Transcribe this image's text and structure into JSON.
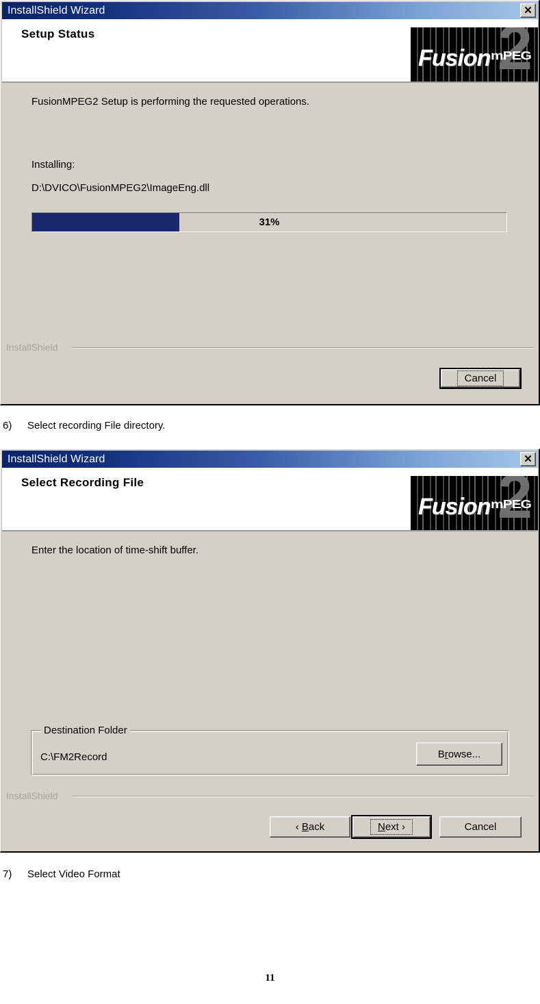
{
  "page": {
    "number": "11"
  },
  "steps": [
    {
      "num": "6)",
      "text": "Select recording File directory."
    },
    {
      "num": "7)",
      "text": "Select Video Format"
    }
  ],
  "logo": {
    "fusion": "Fusion",
    "mpeg": "mPEG",
    "two": "2"
  },
  "dialog1": {
    "titlebar": {
      "title": "InstallShield Wizard",
      "close_label": "✕"
    },
    "banner_title": "Setup Status",
    "message": "FusionMPEG2 Setup is performing the requested operations.",
    "installing_label": "Installing:",
    "installing_path": "D:\\DVICO\\FusionMPEG2\\ImageEng.dll",
    "progress": {
      "percent_label": "31%",
      "percent": 31
    },
    "footer_brand": "InstallShield",
    "buttons": {
      "cancel": "Cancel"
    }
  },
  "dialog2": {
    "titlebar": {
      "title": "InstallShield Wizard",
      "close_label": "✕"
    },
    "banner_title": "Select Recording File",
    "message": "Enter the location of time-shift buffer.",
    "groupbox": {
      "legend": "Destination Folder",
      "path": "C:\\FM2Record",
      "browse_pre": "B",
      "browse_accel": "r",
      "browse_post": "owse..."
    },
    "footer_brand": "InstallShield",
    "buttons": {
      "back_pre": "‹ ",
      "back_accel": "B",
      "back_post": "ack",
      "next_accel": "N",
      "next_post": "ext ›",
      "cancel": "Cancel"
    }
  }
}
